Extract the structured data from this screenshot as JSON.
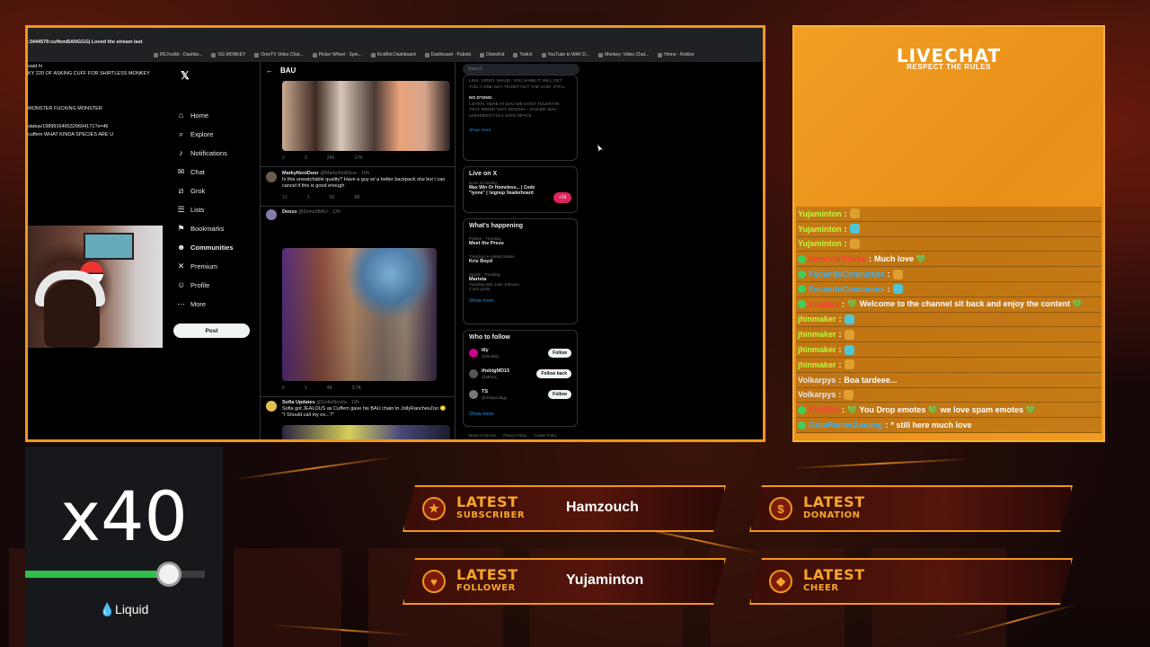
{
  "browser": {
    "bookmarks": [
      "IRLToolkit - Dashbo...",
      "OG MONKEY",
      "OmeTV Video Chat...",
      "Picker Wheel - Spin...",
      "KickBot Dashboard",
      "Dashboard - Pubobi",
      "DistroKid",
      "Twitch",
      "YouTube to WAV D...",
      "Monkey: Video Chat...",
      "Home - Roblox"
    ]
  },
  "stream_chat_left": [
    ":3444579:cuffemBANGGG| Loved the stream last",
    "said hi",
    "KY 220 OF ASKING CUFF FOR SHIRTLESS MONKEY",
    "MONSTER FUCKING MONSTER",
    "status/1989916465329694171?s=46",
    "cuffem WHAT KINDA SPECIES ARE U"
  ],
  "x_nav": {
    "items": [
      {
        "label": "Home",
        "icon": "home-icon"
      },
      {
        "label": "Explore",
        "icon": "search-icon"
      },
      {
        "label": "Notifications",
        "icon": "bell-icon"
      },
      {
        "label": "Chat",
        "icon": "chat-icon"
      },
      {
        "label": "Grok",
        "icon": "grok-icon"
      },
      {
        "label": "Lists",
        "icon": "list-icon"
      },
      {
        "label": "Bookmarks",
        "icon": "bookmark-icon"
      },
      {
        "label": "Communities",
        "icon": "communities-icon"
      },
      {
        "label": "Premium",
        "icon": "x-icon"
      },
      {
        "label": "Profile",
        "icon": "profile-icon"
      },
      {
        "label": "More",
        "icon": "more-icon"
      }
    ],
    "post_label": "Post"
  },
  "feed": {
    "title": "BAU",
    "tweet1_stats": [
      "2",
      "3",
      "245",
      "17K"
    ],
    "tweet2": {
      "name": "MarkyNextDoor",
      "handle": "@MarkyNotDoor · 10h",
      "text": "Is this unwatchable quality? Have a guy w/ a better backpack otw but I can cancel if this is good enough",
      "stats": [
        "12",
        "1",
        "60",
        "8K"
      ]
    },
    "tweet3": {
      "name": "Denzo",
      "handle": "@DenzoBAU · 13h",
      "stats": [
        "6",
        "1",
        "48",
        "3.7K"
      ]
    },
    "tweet4": {
      "name": "Sofia Updates",
      "handle": "@SofiaNovita · 10h",
      "text": "Sofia got JEALOUS as Cuffem gave his BAU chain to JollyRanchexZoo 😳",
      "text2": "\"I Should call my ex...?\""
    }
  },
  "right_side": {
    "search_placeholder": "Search",
    "rules_text": "LINK, VIDEO, IMAGE, YOU NAME IT WILL GET YOU A ONE WAY TICKET OUT THE COM. STFU.",
    "rule_b_title": "NO D*XING",
    "rule_b_text": "LISTEN, HERE AT BAU WE DONT TOLERATE THAT WEIRD SHIT. DOXING = EXILED. BAU UNIVERSITY IS A SAFE SPACE",
    "show_more": "Show more",
    "live_title": "Live on X",
    "live_host": "lyons is hosting",
    "live_text": "Max Win Or Homeless... | Code \"lyons\" | !signup !leaderboard",
    "live_count": "+28",
    "happening_title": "What's happening",
    "trends": [
      {
        "cat": "Politics · Trending",
        "name": "Meet the Press"
      },
      {
        "cat": "Trending in United States",
        "name": "Kris Boyd"
      },
      {
        "cat": "Sports · Trending",
        "name": "Marista",
        "extra": "Trending with Josh Johnson",
        "posts": "2,441 posts"
      }
    ],
    "follow_title": "Who to follow",
    "follows": [
      {
        "name": "lily",
        "handle": "@lanthlily",
        "btn": "Follow"
      },
      {
        "name": "thebigMD15",
        "handle": "@MD15_",
        "btn": "Follow back"
      },
      {
        "name": "TS",
        "handle": "@mrtsprodigy",
        "btn": "Follow"
      }
    ],
    "footer": [
      "Terms of Service",
      "Privacy Policy",
      "Cookie Policy"
    ]
  },
  "livechat": {
    "title": "LIVECHAT",
    "subtitle": "RESPECT THE RULES",
    "messages": [
      {
        "user": "Yujaminton",
        "text": "",
        "color": "#b6ff3a"
      },
      {
        "user": "Yujaminton",
        "text": "",
        "color": "#b6ff3a"
      },
      {
        "user": "Yujaminton",
        "text": "",
        "color": "#b6ff3a"
      },
      {
        "user": "ImmortalFlame",
        "text": "Much love 💚",
        "color": "#ff3b3b"
      },
      {
        "user": "FocandoConcursos",
        "text": "",
        "color": "#35b6ff"
      },
      {
        "user": "FocandoConcursos",
        "text": "",
        "color": "#35b6ff"
      },
      {
        "user": "KickBot",
        "text": "💚 Welcome to the channel sit back and enjoy the content 💚",
        "color": "#ff3b3b"
      },
      {
        "user": "jhinmaker",
        "text": "",
        "color": "#b6ff3a"
      },
      {
        "user": "jhinmaker",
        "text": "",
        "color": "#b6ff3a"
      },
      {
        "user": "jhinmaker",
        "text": "",
        "color": "#b6ff3a"
      },
      {
        "user": "jhinmaker",
        "text": "",
        "color": "#b6ff3a"
      },
      {
        "user": "Volkarpys",
        "text": "Boa tardeee...",
        "color": "#e8e8e8"
      },
      {
        "user": "Volkarpys",
        "text": "",
        "color": "#e8e8e8"
      },
      {
        "user": "KickBot",
        "text": "💚 You Drop emotes 💚 we love spam emotes 💚",
        "color": "#ff3b3b"
      },
      {
        "user": "GrimReeferGaming",
        "text": "* still here much love",
        "color": "#35b6ff"
      }
    ]
  },
  "counter": {
    "value": "x40",
    "brand": "Liquid",
    "progress": 0.8,
    "colors": {
      "fill": "#2fbf4a",
      "track": "#3a3c40"
    }
  },
  "stats": {
    "subscriber": {
      "line1": "LATEST",
      "line2": "SUBSCRIBER",
      "value": "Hamzouch",
      "icon": "star-icon"
    },
    "donation": {
      "line1": "LATEST",
      "line2": "DONATION",
      "value": "",
      "icon": "dollar-icon"
    },
    "follower": {
      "line1": "LATEST",
      "line2": "FOLLOWER",
      "value": "Yujaminton",
      "icon": "heart-icon"
    },
    "cheer": {
      "line1": "LATEST",
      "line2": "CHEER",
      "value": "",
      "icon": "gem-icon"
    }
  },
  "theme": {
    "accent": "#f2961b",
    "panel_orange": "#e88f18",
    "bg": "#1a0c0a"
  }
}
